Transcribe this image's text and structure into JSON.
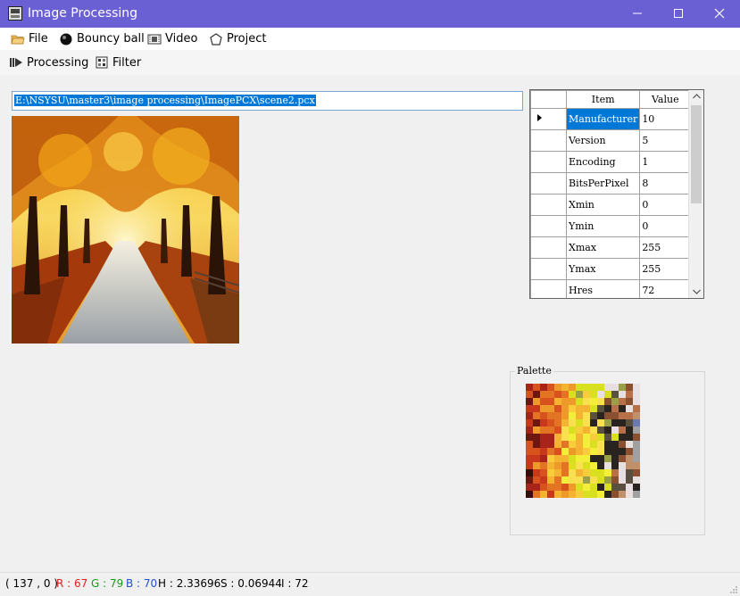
{
  "window": {
    "title": "Image Processing"
  },
  "menu": {
    "items": [
      {
        "label": "File",
        "icon": "folder-icon"
      },
      {
        "label": "Bouncy ball",
        "icon": "ball-icon"
      },
      {
        "label": "Video",
        "icon": "film-icon"
      },
      {
        "label": "Project",
        "icon": "project-icon"
      }
    ]
  },
  "toolbar": {
    "items": [
      {
        "label": "Processing",
        "icon": "processing-icon"
      },
      {
        "label": "Filter",
        "icon": "filter-icon"
      }
    ]
  },
  "path": {
    "value": "E:\\NSYSU\\master3\\image processing\\ImagePCX\\scene2.pcx"
  },
  "header_grid": {
    "columns": [
      "Item",
      "Value"
    ],
    "rows": [
      {
        "item": "Manufacturer",
        "value": "10"
      },
      {
        "item": "Version",
        "value": "5"
      },
      {
        "item": "Encoding",
        "value": "1"
      },
      {
        "item": "BitsPerPixel",
        "value": "8"
      },
      {
        "item": "Xmin",
        "value": "0"
      },
      {
        "item": "Ymin",
        "value": "0"
      },
      {
        "item": "Xmax",
        "value": "255"
      },
      {
        "item": "Ymax",
        "value": "255"
      },
      {
        "item": "Hres",
        "value": "72"
      }
    ],
    "selected_row": 0
  },
  "palette": {
    "label": "Palette"
  },
  "status": {
    "coords": "( 137 , 0 )",
    "r": "R : 67",
    "g": "G : 79",
    "b": "B : 70",
    "h": "H : 2.33696",
    "s": "S : 0.06944",
    "i": "I : 72",
    "colors": {
      "r": "#e02020",
      "g": "#1a9a1a",
      "b": "#2050d0"
    }
  },
  "colors": {
    "titlebar": "#6a5fd3",
    "selection": "#0078d7"
  }
}
